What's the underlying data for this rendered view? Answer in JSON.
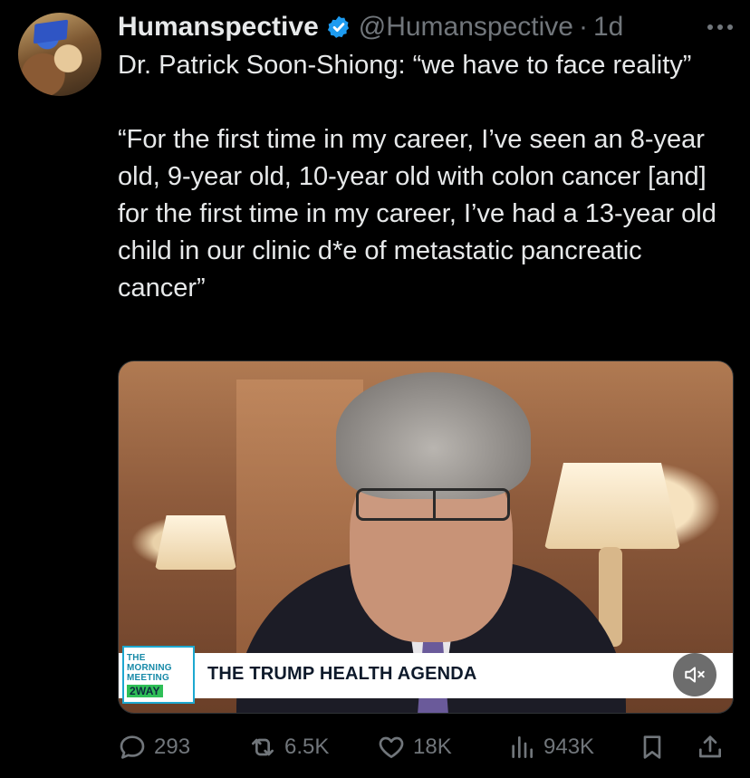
{
  "author": {
    "display_name": "Humanspective",
    "handle": "@Humanspective",
    "separator": "·",
    "time": "1d",
    "verified": true
  },
  "more_icon": "···",
  "text": "Dr. Patrick Soon-Shiong: “we have to face reality”\n\n“For the first time in my career, I’ve seen an 8-year old, 9-year old, 10-year old with colon cancer [and] for the first time in my career, I’ve had a 13-year old child in our clinic d*e of metastatic pancreatic cancer”",
  "media": {
    "logo_line1": "THE",
    "logo_line2": "MORNING",
    "logo_line3": "MEETING",
    "logo_brand": "2WAY",
    "headline": "THE TRUMP HEALTH AGENDA",
    "mute_icon": "speaker-muted-icon"
  },
  "actions": {
    "replies": "293",
    "reposts": "6.5K",
    "likes": "18K",
    "views": "943K"
  },
  "colors": {
    "background": "#000000",
    "text": "#e7e9ea",
    "muted": "#71767b",
    "verified_badge": "#1d9bf0"
  }
}
